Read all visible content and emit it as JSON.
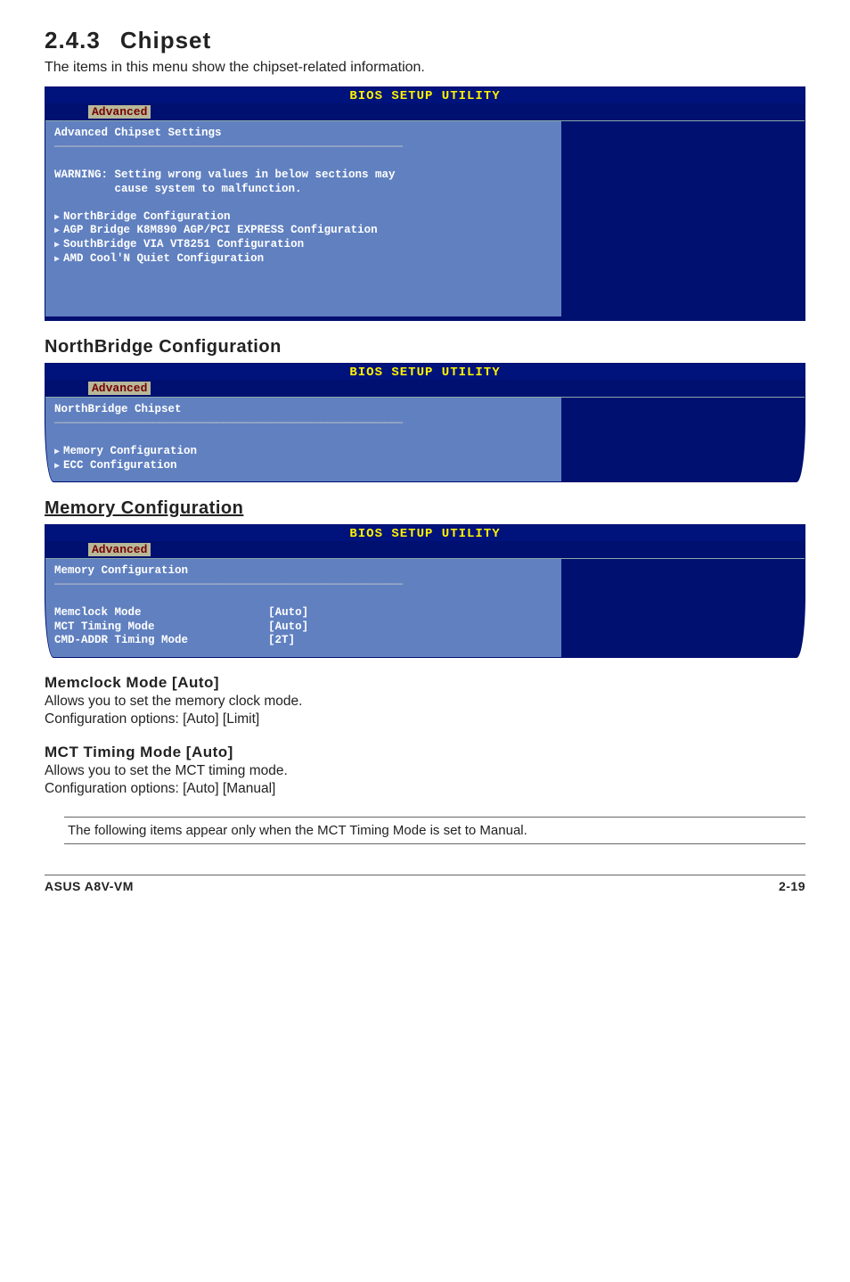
{
  "section": {
    "number": "2.4.3",
    "title": "Chipset"
  },
  "intro": "The items in this menu show the chipset-related information.",
  "bios_header": "BIOS SETUP UTILITY",
  "tab_label": "Advanced",
  "panel1": {
    "title": "Advanced Chipset Settings",
    "warning_l1": "WARNING: Setting wrong values in below sections may",
    "warning_l2": "         cause system to malfunction.",
    "items": [
      "NorthBridge Configuration",
      "AGP Bridge K8M890 AGP/PCI EXPRESS Configuration",
      "SouthBridge VIA VT8251 Configuration",
      "AMD Cool'N Quiet Configuration"
    ]
  },
  "northbridge_heading": "NorthBridge Configuration",
  "panel2": {
    "title": "NorthBridge Chipset",
    "items": [
      "Memory Configuration",
      "ECC Configuration"
    ]
  },
  "memcfg_heading": "Memory Configuration",
  "panel3": {
    "title": "Memory Configuration",
    "rows": [
      {
        "label": "Memclock Mode",
        "value": "[Auto]"
      },
      {
        "label": "MCT Timing Mode",
        "value": "[Auto]"
      },
      {
        "label": "CMD-ADDR Timing Mode",
        "value": "[2T]"
      }
    ]
  },
  "fields": {
    "memclock": {
      "heading": "Memclock Mode [Auto]",
      "l1": "Allows you to set the memory clock mode.",
      "l2": "Configuration options: [Auto] [Limit]"
    },
    "mct": {
      "heading": "MCT Timing Mode [Auto]",
      "l1": "Allows you to set the MCT timing mode.",
      "l2": "Configuration options: [Auto] [Manual]"
    }
  },
  "note": "The following items appear only when the MCT Timing Mode is set to Manual.",
  "footer": {
    "left": "ASUS A8V-VM",
    "right": "2-19"
  }
}
